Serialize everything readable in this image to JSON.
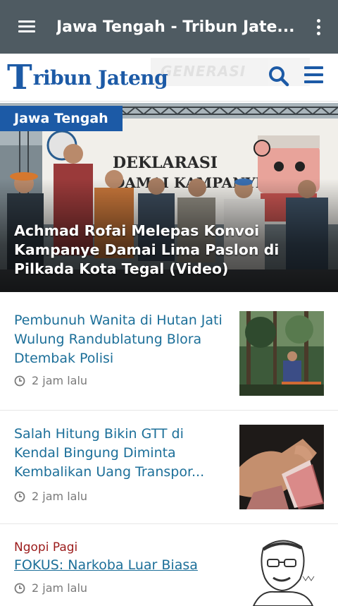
{
  "app_bar": {
    "title": "Jawa Tengah - Tribun Jate...",
    "menu_icon": "hamburger-menu-icon",
    "overflow_icon": "more-vert-icon"
  },
  "site_header": {
    "logo_initial": "T",
    "logo_text": "ribun Jateng",
    "banner_text": "GENERASI",
    "search_icon": "search-icon",
    "menu_icon": "hamburger-menu-icon"
  },
  "hero": {
    "category": "Jawa Tengah",
    "headline": "Achmad Rofai Melepas Konvoi Kampanye Damai Lima Paslon di Pilkada Kota Tegal (Video)",
    "photo_banner_text": "DEKLARASI DAMAI KAMPANYE"
  },
  "articles": [
    {
      "kicker": "",
      "headline": "Pembunuh Wanita di Hutan Jati Wulung Randublatung Blora Dtembak Polisi",
      "time": "2 jam lalu",
      "thumb": "forest-crime-scene-photo"
    },
    {
      "kicker": "",
      "headline": "Salah Hitung Bikin GTT di Kendal Bingung Diminta Kembalikan Uang Transpor...",
      "time": "2 jam lalu",
      "thumb": "counting-money-photo"
    },
    {
      "kicker": "Ngopi Pagi",
      "headline": "FOKUS: Narkoba Luar Biasa",
      "time": "2 jam lalu",
      "thumb": "columnist-sketch-portrait"
    }
  ],
  "colors": {
    "app_bar": "#4f5b62",
    "brand_blue": "#1c5aa6",
    "headline_blue": "#1c6f99",
    "kicker_red": "#9b1b1b",
    "meta_grey": "#7a7a7a"
  }
}
